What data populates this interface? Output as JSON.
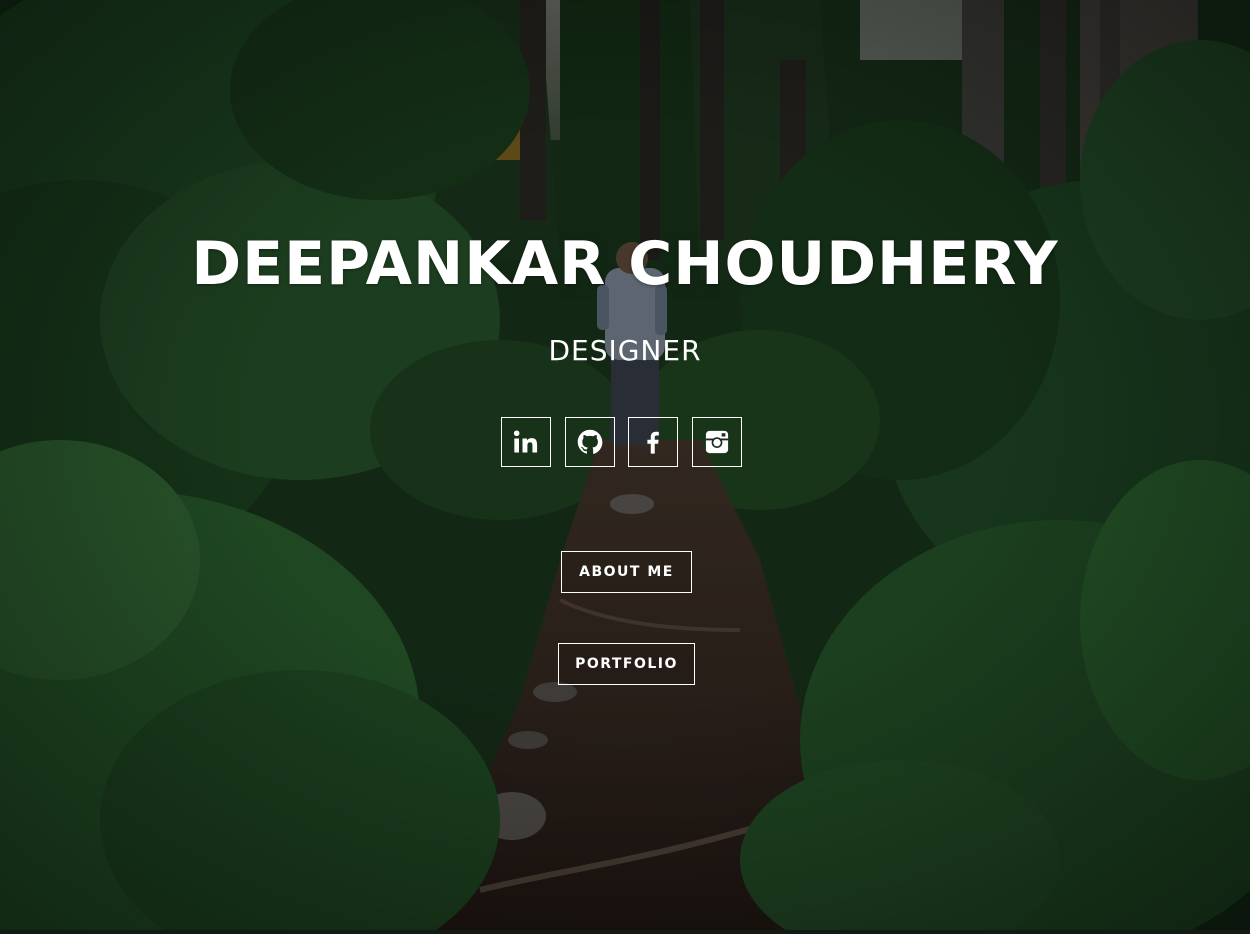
{
  "hero": {
    "name": "DEEPANKAR CHOUDHERY",
    "role": "DESIGNER",
    "social": [
      {
        "icon": "linkedin-icon",
        "label": "LinkedIn"
      },
      {
        "icon": "github-icon",
        "label": "GitHub"
      },
      {
        "icon": "facebook-icon",
        "label": "Facebook"
      },
      {
        "icon": "instagram-icon",
        "label": "Instagram"
      }
    ],
    "buttons": {
      "about": "ABOUT ME",
      "portfolio": "PORTFOLIO"
    }
  },
  "colors": {
    "text": "#ffffff",
    "overlay": "rgba(0,0,0,0.45)",
    "foliage": "#1f4a22",
    "path": "#3a2a22"
  }
}
